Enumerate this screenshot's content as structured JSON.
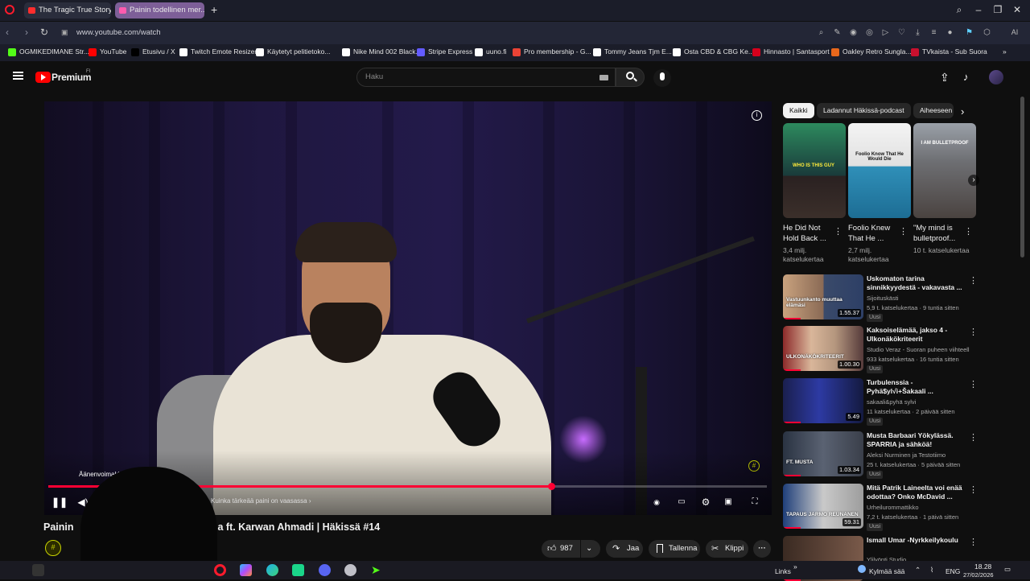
{
  "browser": {
    "tabs": [
      {
        "label": "The Tragic True Story of J..."
      },
      {
        "label": "Painin todellinen mer..."
      }
    ],
    "new_tab": "+",
    "window_controls": {
      "search": "⌕",
      "minimize": "–",
      "restore": "❐",
      "close": "✕"
    },
    "url": "www.youtube.com/watch",
    "ai_label": "AI",
    "bookmarks": [
      {
        "label": "OGMIKEDIMANE Str...",
        "color": "#53fc18"
      },
      {
        "label": "YouTube",
        "color": "#ff0000"
      },
      {
        "label": "Etusivu / X",
        "color": "#000000"
      },
      {
        "label": "Twitch Emote Resizer",
        "color": "#ffffff"
      },
      {
        "label": "Käytetyt pelitietoko...",
        "color": "#ffffff"
      },
      {
        "label": "Nike Mind 002 Black...",
        "color": "#ffffff"
      },
      {
        "label": "Stripe Express",
        "color": "#635bff"
      },
      {
        "label": "uuno.fi",
        "color": "#ffffff"
      },
      {
        "label": "Pro membership - G...",
        "color": "#ea4335"
      },
      {
        "label": "Tommy Jeans Tjm E...",
        "color": "#ffffff"
      },
      {
        "label": "Osta CBD & CBG Ke...",
        "color": "#ffffff"
      },
      {
        "label": "Hinnasto | Santasport",
        "color": "#d6001c"
      },
      {
        "label": "Oakley Retro Sungla...",
        "color": "#e8671b"
      },
      {
        "label": "TVkaista - Sub Suora",
        "color": "#c8102e"
      }
    ]
  },
  "youtube": {
    "logo": "Premium",
    "logo_sup": "FI",
    "search_placeholder": "Haku",
    "video": {
      "volume_label": "Äänenvoimakkuus",
      "chapter": "Kuinka tärkeää paini on vaasassa",
      "title": "Painin todellinen merkitys ja Karwan Ahmadi | Häkissä #14",
      "title_visible_start": "Painin",
      "title_visible_end": "a ft. Karwan Ahmadi | Häkissä #14",
      "progress": 0.7
    },
    "actions": {
      "likes": "987",
      "share": "Jaa",
      "save": "Tallenna",
      "clip": "Klippi"
    },
    "chips": [
      "Kaikki",
      "Ladannut Häkissä-podcast",
      "Aiheeseen"
    ],
    "shorts": [
      {
        "title": "He Did Not Hold Back ...",
        "views": "3,4 milj. katselukertaa",
        "caption": "WHO IS THIS GUY"
      },
      {
        "title": "Foolio Knew That He ...",
        "views": "2,7 milj. katselukertaa",
        "caption": "Foolio Know That He Would Die"
      },
      {
        "title": "\"My mind is bulletproof...",
        "views": "10 t. katselukertaa",
        "caption": "I AM BULLETPROOF"
      }
    ],
    "related": [
      {
        "title": "Uskomaton tarina sinnikkyydestä - vakavasta ...",
        "channel": "Sijoituskästi",
        "meta": "5,9 t. katselukertaa · 9 tuntia sitten",
        "badge": "Uusi",
        "duration": "1.55.37",
        "thumb_text": "Vastuunkanto muuttaa elämäsi"
      },
      {
        "title": "Kaksoiselämää, jakso 4 - Ulkonäkökriteerit",
        "channel": "Studio Veraz - Suoran puheen viihteelli...",
        "meta": "933 katselukertaa · 16 tuntia sitten",
        "badge": "Uusi",
        "duration": "1.00.30",
        "thumb_text": "ULKONÄKÖKRITEERIT"
      },
      {
        "title": "Turbulenssia - Pyhä$yl√i+Šakaali ...",
        "channel": "sakaali&pyhä sylvi",
        "meta": "11 katselukertaa · 2 päivää sitten",
        "badge": "Uusi",
        "duration": "5.49",
        "thumb_text": ""
      },
      {
        "title": "Musta Barbaari Yökylässä. SPARRIA ja sähköä!",
        "channel": "Aleksi Nurminen ja Testotiimo",
        "meta": "25 t. katselukertaa · 5 päivää sitten",
        "badge": "Uusi",
        "duration": "1.03.34",
        "thumb_text": "FT. MUSTA"
      },
      {
        "title": "Mitä Patrik Laineelta voi enää odottaa? Onko McDavid ...",
        "channel": "Urheilurommattikko",
        "meta": "7,2 t. katselukertaa · 1 päivä sitten",
        "badge": "Uusi",
        "duration": "59.31",
        "thumb_text": "TAPAUS JARMO REUNANEN"
      },
      {
        "title": "Ismall Umar -Nyrkkeilykoulu",
        "channel": "Ylilyönti Studio",
        "meta": "",
        "badge": "",
        "duration": "",
        "thumb_text": ""
      }
    ]
  },
  "taskbar": {
    "links": "Links",
    "weather": "Kylmää sää",
    "lang": "ENG",
    "time": "18.28",
    "date": "27/02/2026"
  }
}
